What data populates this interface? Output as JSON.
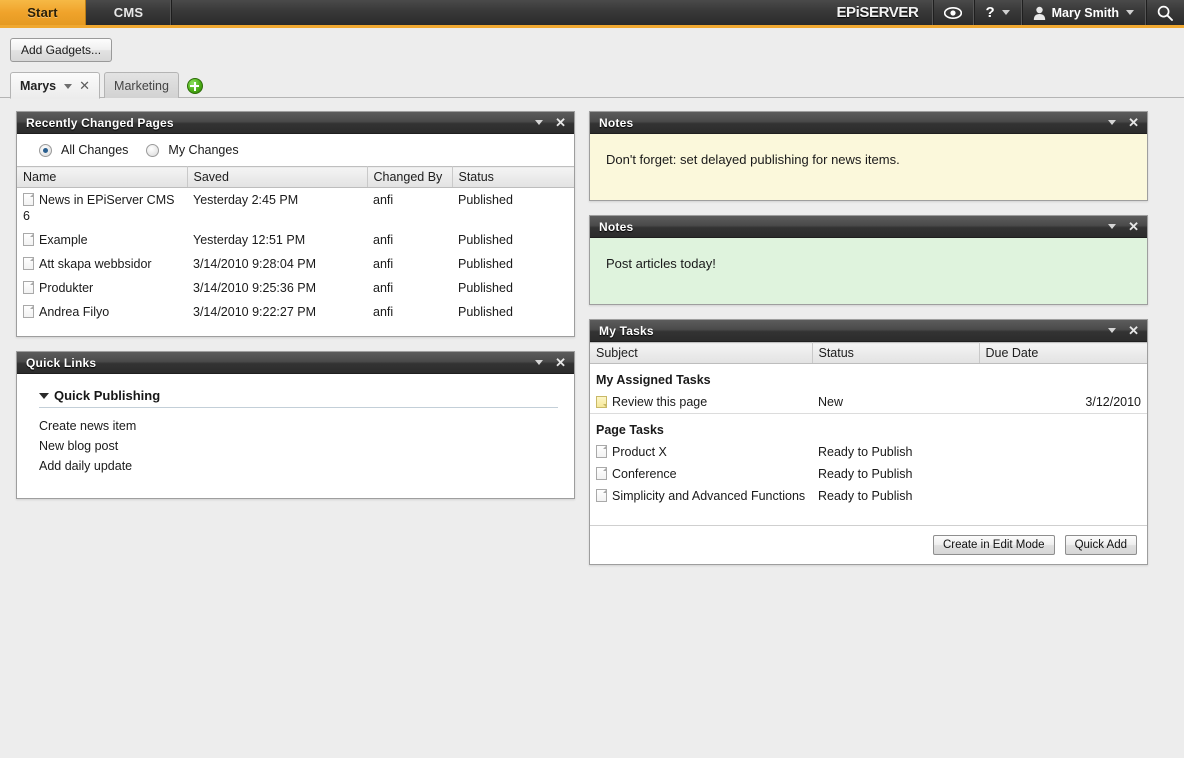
{
  "topbar": {
    "nav_tabs": [
      {
        "label": "Start",
        "active": true
      },
      {
        "label": "CMS",
        "active": false
      }
    ],
    "logo_first": "EPi",
    "logo_second": "SERVER",
    "view_icon": "eye-icon",
    "help_label": "?",
    "user_name": "Mary Smith",
    "user_icon": "user-avatar-icon",
    "search_icon": "search-icon",
    "accent_color": "#f0a830"
  },
  "toolbar": {
    "add_gadgets_label": "Add Gadgets..."
  },
  "dashboard_tabs": {
    "tabs": [
      {
        "label": "Marys",
        "active": true,
        "has_caret": true,
        "has_close": true
      },
      {
        "label": "Marketing",
        "active": false,
        "has_caret": false,
        "has_close": false
      }
    ],
    "add_tab_icon": "plus-icon"
  },
  "recently_changed": {
    "title": "Recently Changed Pages",
    "filters": [
      {
        "label": "All Changes",
        "selected": true
      },
      {
        "label": "My Changes",
        "selected": false
      }
    ],
    "columns": [
      "Name",
      "Saved",
      "Changed By",
      "Status"
    ],
    "rows": [
      {
        "name": "News in EPiServer CMS 6",
        "saved": "Yesterday 2:45 PM",
        "changed_by": "anfi",
        "status": "Published"
      },
      {
        "name": "Example",
        "saved": "Yesterday 12:51 PM",
        "changed_by": "anfi",
        "status": "Published"
      },
      {
        "name": "Att skapa webbsidor",
        "saved": "3/14/2010 9:28:04 PM",
        "changed_by": "anfi",
        "status": "Published"
      },
      {
        "name": "Produkter",
        "saved": "3/14/2010 9:25:36 PM",
        "changed_by": "anfi",
        "status": "Published"
      },
      {
        "name": "Andrea Filyo",
        "saved": "3/14/2010 9:22:27 PM",
        "changed_by": "anfi",
        "status": "Published"
      }
    ]
  },
  "quick_links": {
    "title": "Quick Links",
    "section_label": "Quick Publishing",
    "links": [
      "Create news item",
      "New blog post",
      "Add daily update"
    ]
  },
  "notes": [
    {
      "title": "Notes",
      "text": "Don't forget: set delayed publishing for news items.",
      "color": "#fbf8db"
    },
    {
      "title": "Notes",
      "text": "Post articles today!",
      "color": "#dff3dd"
    }
  ],
  "my_tasks": {
    "title": "My Tasks",
    "columns": [
      "Subject",
      "Status",
      "Due Date"
    ],
    "groups": [
      {
        "label": "My Assigned Tasks",
        "rows": [
          {
            "icon": "note-icon",
            "subject": "Review this page",
            "status": "New",
            "due_date": "3/12/2010"
          }
        ]
      },
      {
        "label": "Page Tasks",
        "rows": [
          {
            "icon": "page-icon",
            "subject": "Product X",
            "status": "Ready to Publish",
            "due_date": ""
          },
          {
            "icon": "page-icon",
            "subject": "Conference",
            "status": "Ready to Publish",
            "due_date": ""
          },
          {
            "icon": "page-icon",
            "subject": "Simplicity and Advanced Functions",
            "status": "Ready to Publish",
            "due_date": ""
          }
        ]
      }
    ],
    "create_button": "Create in Edit Mode",
    "quick_add_button": "Quick Add"
  }
}
